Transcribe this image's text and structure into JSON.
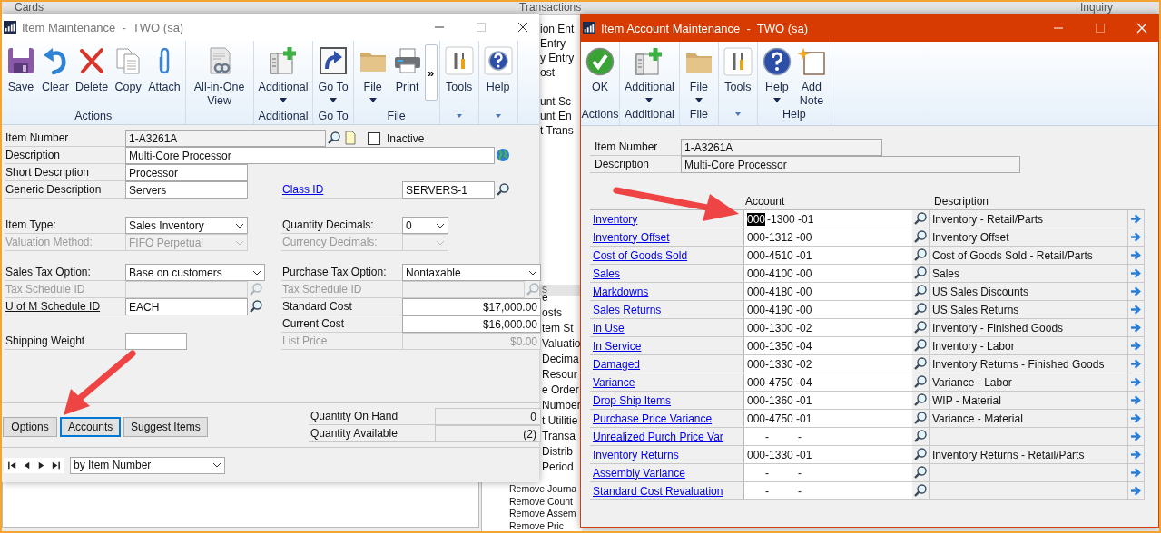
{
  "desktop": {
    "headers": [
      {
        "title": "Cards"
      },
      {
        "title": "Transactions"
      },
      {
        "title": "Inquiry"
      }
    ],
    "list_top": [
      "ion Ent",
      "Entry",
      "y Entry",
      "ost"
    ],
    "list_top_2": [
      "unt Sc",
      "unt En",
      "t Trans"
    ],
    "list_header": "s",
    "list_middle": [
      "e",
      "osts",
      "tem St",
      "Valuatio",
      "Decima",
      "Resour",
      "e Order",
      "Number",
      "t Utilitie",
      "Transa",
      "Distrib",
      "Period"
    ],
    "list_bottom": [
      "Remove Journa",
      "Remove Count",
      "Remove Assem",
      "Remove Pric"
    ]
  },
  "item_window": {
    "title": "Item Maintenance  -  TWO (sa)",
    "ribbon": [
      {
        "kind": "labeled",
        "label": "Actions",
        "buttons": [
          {
            "label": "Save",
            "dropdown": false
          },
          {
            "label": "Clear",
            "dropdown": false
          },
          {
            "label": "Delete",
            "dropdown": false
          },
          {
            "label": "Copy",
            "dropdown": false
          },
          {
            "label": "Attach",
            "dropdown": false
          }
        ]
      },
      {
        "kind": "plain",
        "buttons": [
          {
            "label": "All-in-One View",
            "dropdown": false
          }
        ]
      },
      {
        "kind": "labeled",
        "label": "Additional",
        "buttons": [
          {
            "label": "Additional",
            "dropdown": true
          }
        ]
      },
      {
        "kind": "labeled",
        "label": "Go To",
        "buttons": [
          {
            "label": "Go To",
            "dropdown": true
          }
        ]
      },
      {
        "kind": "labeled",
        "label": "File",
        "buttons": [
          {
            "label": "File",
            "dropdown": true
          },
          {
            "label": "Print",
            "dropdown": false
          }
        ],
        "overflow": "»"
      },
      {
        "kind": "menu",
        "buttons": [
          {
            "label": "Tools",
            "dropdown": false
          }
        ]
      },
      {
        "kind": "menu",
        "buttons": [
          {
            "label": "Help",
            "dropdown": false
          }
        ]
      }
    ],
    "form": {
      "item_number": {
        "label": "Item Number",
        "value": "1-A3261A"
      },
      "inactive": {
        "label": "Inactive",
        "checked": false
      },
      "description": {
        "label": "Description",
        "value": "Multi-Core Processor"
      },
      "short_description": {
        "label": "Short Description",
        "value": "Processor"
      },
      "generic_description": {
        "label": "Generic Description",
        "value": "Servers"
      },
      "class_id": {
        "label": "Class ID",
        "value": "SERVERS-1"
      },
      "item_type": {
        "label": "Item Type:",
        "value": "Sales Inventory",
        "disabled": false
      },
      "quantity_decimals": {
        "label": "Quantity Decimals:",
        "value": "0",
        "disabled": false
      },
      "valuation_method": {
        "label": "Valuation Method:",
        "value": "FIFO Perpetual",
        "disabled": true
      },
      "currency_decimals": {
        "label": "Currency Decimals:",
        "disabled": true
      },
      "sales_tax_option": {
        "label": "Sales Tax Option:",
        "value": "Base on customers",
        "disabled": false
      },
      "purchase_tax_option": {
        "label": "Purchase Tax Option:",
        "value": "Nontaxable",
        "disabled": false
      },
      "sales_tax_schedule": {
        "label": "Tax Schedule ID",
        "disabled": true
      },
      "purchase_tax_schedule": {
        "label": "Tax Schedule ID",
        "disabled": true
      },
      "u_of_m_schedule": {
        "label": "U of M Schedule ID",
        "value": "EACH"
      },
      "standard_cost": {
        "label": "Standard Cost",
        "value": "$17,000.00"
      },
      "current_cost": {
        "label": "Current Cost",
        "value": "$16,000.00"
      },
      "shipping_weight": {
        "label": "Shipping Weight"
      },
      "list_price": {
        "label": "List Price",
        "value": "$0.00",
        "disabled": true
      }
    },
    "buttons": [
      {
        "label": "Options",
        "focused": false
      },
      {
        "label": "Accounts",
        "focused": true
      },
      {
        "label": "Suggest Items",
        "focused": false
      }
    ],
    "quantities": [
      {
        "label": "Quantity On Hand",
        "value": "0"
      },
      {
        "label": "Quantity Available",
        "value": "(2)"
      }
    ],
    "sort": {
      "value": "by Item Number"
    }
  },
  "account_window": {
    "title": "Item Account Maintenance  -  TWO (sa)",
    "ribbon": [
      {
        "kind": "labeled",
        "label": "Actions",
        "buttons": [
          {
            "label": "OK",
            "dropdown": false
          }
        ]
      },
      {
        "kind": "labeled",
        "label": "Additional",
        "buttons": [
          {
            "label": "Additional",
            "dropdown": true
          }
        ]
      },
      {
        "kind": "labeled",
        "label": "File",
        "buttons": [
          {
            "label": "File",
            "dropdown": true
          }
        ]
      },
      {
        "kind": "menu",
        "buttons": [
          {
            "label": "Tools",
            "dropdown": false
          }
        ]
      },
      {
        "kind": "labeled",
        "label": "Help",
        "buttons": [
          {
            "label": "Help",
            "dropdown": true
          },
          {
            "label": "Add Note",
            "dropdown": false
          }
        ]
      }
    ],
    "item_number": {
      "label": "Item Number",
      "value": "1-A3261A"
    },
    "description": {
      "label": "Description",
      "value": "Multi-Core Processor"
    },
    "columns": [
      "Account",
      "Description"
    ],
    "rows": [
      {
        "label": "Inventory",
        "account": [
          "000",
          "-1300",
          "-01"
        ],
        "description": "Inventory - Retail/Parts",
        "focused": true
      },
      {
        "label": "Inventory Offset",
        "account": [
          "000",
          "-1312",
          "-00"
        ],
        "description": "Inventory Offset",
        "focused": false
      },
      {
        "label": "Cost of Goods Sold",
        "account": [
          "000",
          "-4510",
          "-01"
        ],
        "description": "Cost of Goods Sold - Retail/Parts",
        "focused": false
      },
      {
        "label": "Sales",
        "account": [
          "000",
          "-4100",
          "-00"
        ],
        "description": "Sales",
        "focused": false
      },
      {
        "label": "Markdowns",
        "account": [
          "000",
          "-4180",
          "-00"
        ],
        "description": "US Sales Discounts",
        "focused": false
      },
      {
        "label": "Sales Returns",
        "account": [
          "000",
          "-4190",
          "-00"
        ],
        "description": "US Sales Returns",
        "focused": false
      },
      {
        "label": "In Use",
        "account": [
          "000",
          "-1300",
          "-02"
        ],
        "description": "Inventory - Finished Goods",
        "focused": false
      },
      {
        "label": "In Service",
        "account": [
          "000",
          "-1350",
          "-04"
        ],
        "description": "Inventory - Labor",
        "focused": false
      },
      {
        "label": "Damaged",
        "account": [
          "000",
          "-1330",
          "-02"
        ],
        "description": "Inventory Returns - Finished Goods",
        "focused": false
      },
      {
        "label": "Variance",
        "account": [
          "000",
          "-4750",
          "-04"
        ],
        "description": "Variance - Labor",
        "focused": false
      },
      {
        "label": "Drop Ship Items",
        "account": [
          "000",
          "-1360",
          "-01"
        ],
        "description": "WIP - Material",
        "focused": false
      },
      {
        "label": "Purchase Price Variance",
        "account": [
          "000",
          "-4750",
          "-01"
        ],
        "description": "Variance - Material",
        "focused": false
      },
      {
        "label": "Unrealized Purch Price Var",
        "account": [
          "-",
          "-"
        ],
        "focused": false
      },
      {
        "label": "Inventory Returns",
        "account": [
          "000",
          "-1330",
          "-01"
        ],
        "description": "Inventory Returns - Retail/Parts",
        "focused": false
      },
      {
        "label": "Assembly Variance",
        "account": [
          "-",
          "-"
        ],
        "focused": false
      },
      {
        "label": "Standard Cost Revaluation",
        "account": [
          "-",
          "-"
        ],
        "focused": false
      }
    ]
  }
}
